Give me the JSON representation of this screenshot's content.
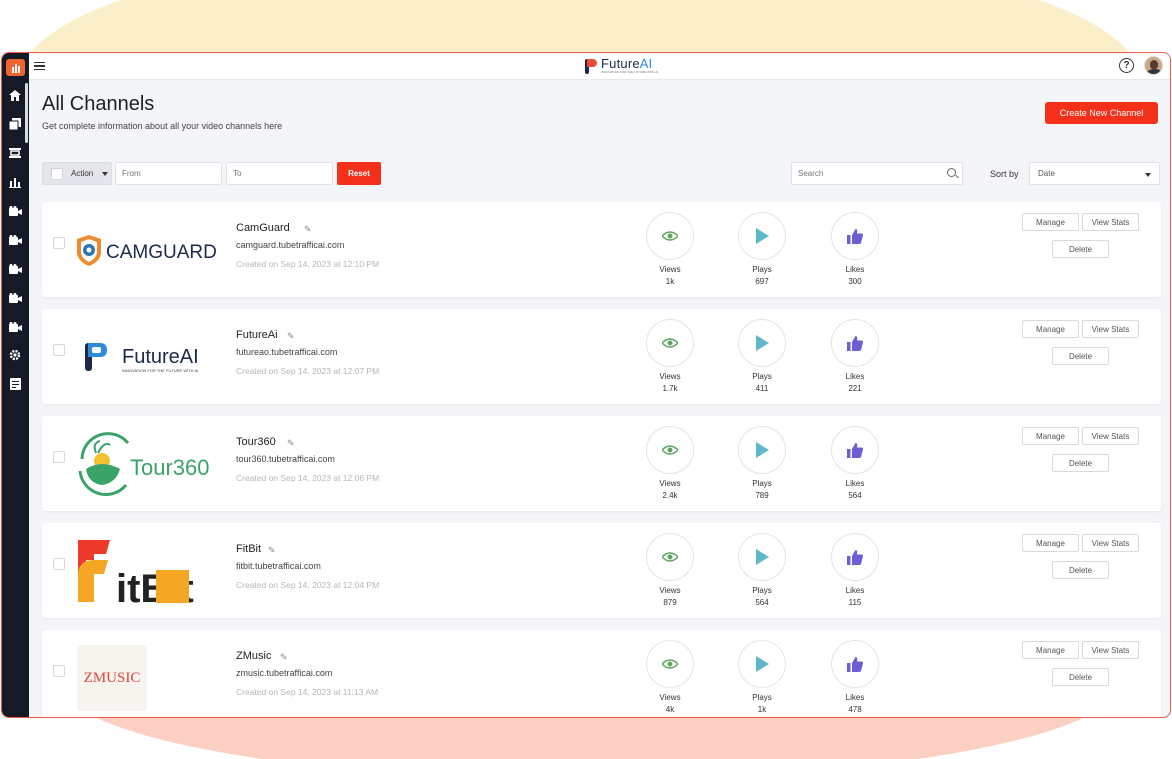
{
  "header": {
    "brand_name": "Future",
    "brand_name_accent": "AI",
    "brand_tagline": "INNOVATION FOR THE FUTURE WITH AI",
    "help_label": "?"
  },
  "page": {
    "title": "All Channels",
    "subtitle": "Get complete information about all your video channels here",
    "create_button": "Create New Channel"
  },
  "filters": {
    "action_label": "Action",
    "from_placeholder": "From",
    "to_placeholder": "To",
    "reset_label": "Reset",
    "search_placeholder": "Search",
    "sort_label": "Sort by",
    "sort_value": "Date"
  },
  "sidebar": {
    "icons": [
      "home-icon",
      "copy-icon",
      "layout-icon",
      "bar-chart-icon",
      "video-icon",
      "video-icon",
      "video-icon",
      "video-icon",
      "video-icon",
      "settings-icon",
      "document-icon"
    ]
  },
  "card_labels": {
    "views": "Views",
    "plays": "Plays",
    "likes": "Likes",
    "manage": "Manage",
    "view_stats": "View Stats",
    "delete": "Delete"
  },
  "channels": [
    {
      "name": "CamGuard",
      "url": "camguard.tubetrafficai.com",
      "created": "Created on Sep 14, 2023 at 12:10 PM",
      "views": "1k",
      "plays": "697",
      "likes": "300",
      "logo_text": "CAMGUARD"
    },
    {
      "name": "FutureAi",
      "url": "futureao.tubetrafficai.com",
      "created": "Created on Sep 14, 2023 at 12:07 PM",
      "views": "1.7k",
      "plays": "411",
      "likes": "221",
      "logo_text": "FutureAI",
      "logo_tagline": "INNOVATION FOR THE FUTURE WITH AI"
    },
    {
      "name": "Tour360",
      "url": "tour360.tubetrafficai.com",
      "created": "Created on Sep 14, 2023 at 12:06 PM",
      "views": "2.4k",
      "plays": "789",
      "likes": "564",
      "logo_text": "Tour360"
    },
    {
      "name": "FitBit",
      "url": "fitbit.tubetrafficai.com",
      "created": "Created on Sep 14, 2023 at 12:04 PM",
      "views": "879",
      "plays": "564",
      "likes": "115",
      "logo_text": "itBit"
    },
    {
      "name": "ZMusic",
      "url": "zmusic.tubetrafficai.com",
      "created": "Created on Sep 14, 2023 at 11:13 AM",
      "views": "4k",
      "plays": "1k",
      "likes": "478",
      "logo_text": "ZMUSIC"
    }
  ],
  "colors": {
    "accent": "#f4301b",
    "sidebar": "#141a26",
    "views_icon": "#5fa463",
    "plays_icon": "#5fb8c9",
    "likes_icon": "#6c5fd6"
  }
}
